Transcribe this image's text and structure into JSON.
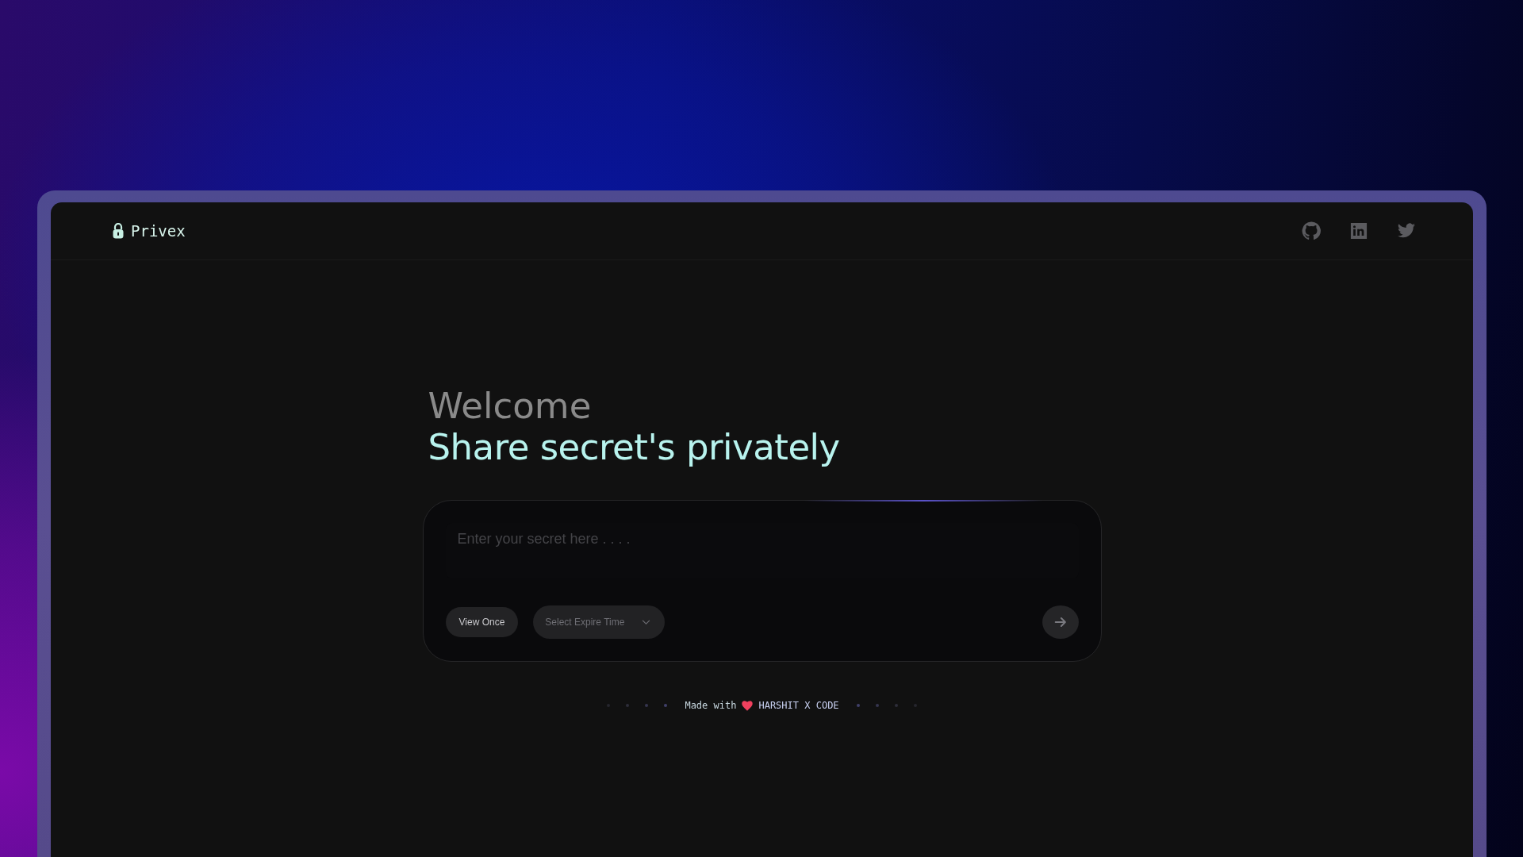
{
  "brand": {
    "name": "Privex"
  },
  "hero": {
    "greeting": "Welcome",
    "headline": "Share secret's privately"
  },
  "secret_form": {
    "placeholder": "Enter your secret here . . . .",
    "view_once_button": "View Once",
    "expire_select": {
      "placeholder": "Select Expire Time"
    }
  },
  "footer": {
    "made_with": "Made with",
    "author": "HARSHIT X CODE"
  }
}
